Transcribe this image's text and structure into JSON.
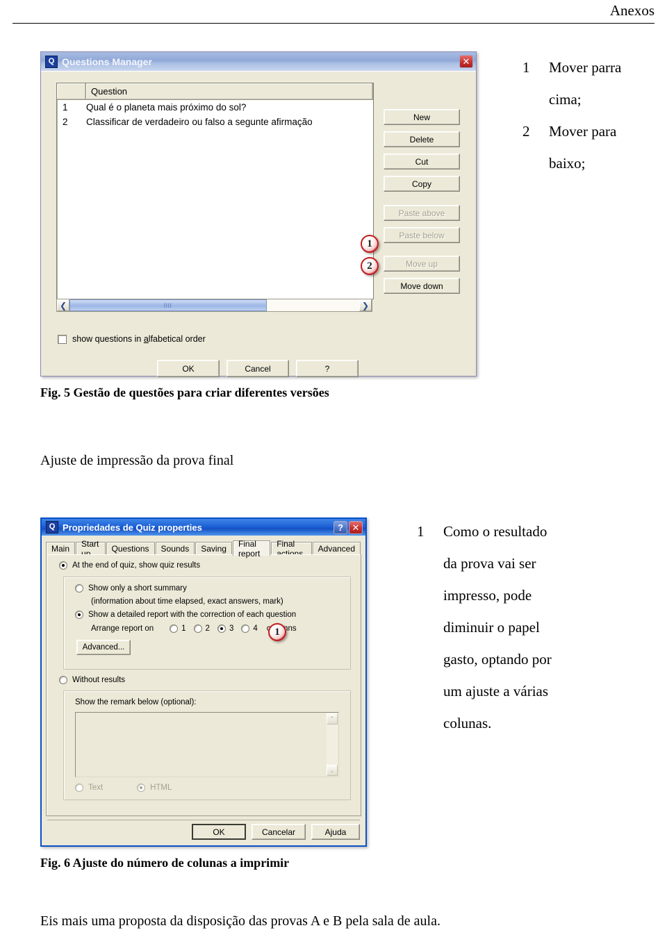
{
  "page": {
    "header": "Anexos"
  },
  "figure5": {
    "dialog": {
      "title": "Questions Manager",
      "app_icon": "Q",
      "close_icon": "close-icon",
      "list": {
        "header_number": "",
        "header_question": "Question",
        "rows": [
          {
            "num": "1",
            "text": "Qual é o planeta mais próximo do sol?"
          },
          {
            "num": "2",
            "text": "Classificar de verdadeiro ou falso a segunte afirmação"
          }
        ]
      },
      "scrollbar": {
        "left_arrow": "❮",
        "right_arrow": "❯",
        "grip": "llll"
      },
      "checkbox": {
        "checked": false,
        "label_before": "show questions in ",
        "label_accel": "a",
        "label_after": "lfabetical order"
      },
      "side_buttons": [
        {
          "label": "New",
          "enabled": true
        },
        {
          "label": "Delete",
          "enabled": true
        },
        {
          "label": "Cut",
          "enabled": true
        },
        {
          "label": "Copy",
          "enabled": true
        },
        {
          "label": "Paste above",
          "enabled": false
        },
        {
          "label": "Paste below",
          "enabled": false
        },
        {
          "label": "Move up",
          "enabled": false
        },
        {
          "label": "Move down",
          "enabled": true
        }
      ],
      "bottom_buttons": [
        {
          "label": "OK"
        },
        {
          "label": "Cancel"
        },
        {
          "label": "?"
        }
      ],
      "badges": [
        {
          "number": "1"
        },
        {
          "number": "2"
        }
      ]
    },
    "side_notes": [
      {
        "num": "1",
        "line1": "Mover parra",
        "line2": "cima;"
      },
      {
        "num": "2",
        "line1": "Mover para",
        "line2": "baixo;"
      }
    ],
    "caption": "Fig. 5 Gestão de questões para criar diferentes versões"
  },
  "section_heading": "Ajuste de impressão da prova final",
  "figure6": {
    "dialog": {
      "title": "Propriedades de Quiz properties",
      "app_icon": "Q",
      "help_icon": "help-icon",
      "close_icon": "close-icon",
      "tabs": [
        {
          "label": "Main",
          "active": false
        },
        {
          "label": "Start up",
          "active": false
        },
        {
          "label": "Questions",
          "active": false
        },
        {
          "label": "Sounds",
          "active": false
        },
        {
          "label": "Saving",
          "active": false
        },
        {
          "label": "Final report",
          "active": true
        },
        {
          "label": "Final actions",
          "active": false
        },
        {
          "label": "Advanced",
          "active": false
        }
      ],
      "option_show_results": {
        "label": "At the end of quiz, show quiz results",
        "selected": true
      },
      "option_short_summary": {
        "label": "Show only a short summary",
        "hint": "(information about time elapsed, exact answers, mark)",
        "selected": false
      },
      "option_detailed_report": {
        "label": "Show a detailed report with the correction of each question",
        "selected": true
      },
      "arrange": {
        "label": "Arrange report on",
        "suffix": "columns",
        "options": [
          "1",
          "2",
          "3",
          "4"
        ],
        "selected": "3"
      },
      "advanced_button": "Advanced...",
      "option_without_results": {
        "label": "Without results",
        "selected": false
      },
      "remark": {
        "label": "Show the remark below (optional):",
        "value": "",
        "scroll_up_icon": "⌃",
        "scroll_down_icon": "⌄"
      },
      "format_options": [
        {
          "label": "Text",
          "selected": false
        },
        {
          "label": "HTML",
          "selected": true
        }
      ],
      "footer_buttons": [
        {
          "label": "OK",
          "default": true
        },
        {
          "label": "Cancelar",
          "default": false
        },
        {
          "label": "Ajuda",
          "default": false
        }
      ],
      "badges": [
        {
          "number": "1"
        }
      ]
    },
    "side_note": {
      "num": "1",
      "lines": [
        "Como o resultado",
        "da prova vai ser",
        "impresso, pode",
        "diminuir o papel",
        "gasto, optando por",
        "um ajuste a várias",
        "colunas."
      ]
    },
    "caption": "Fig. 6 Ajuste do número de colunas a imprimir"
  },
  "closing_paragraph": "Eis mais uma proposta da disposição das provas A e B pela sala de aula.",
  "colors": {
    "badge_ring": "#c21d1d",
    "dialog_face": "#ece9d8",
    "titlebar_blue": "#1b5fd4",
    "titlebar_lavender": "#8fa8d8"
  }
}
